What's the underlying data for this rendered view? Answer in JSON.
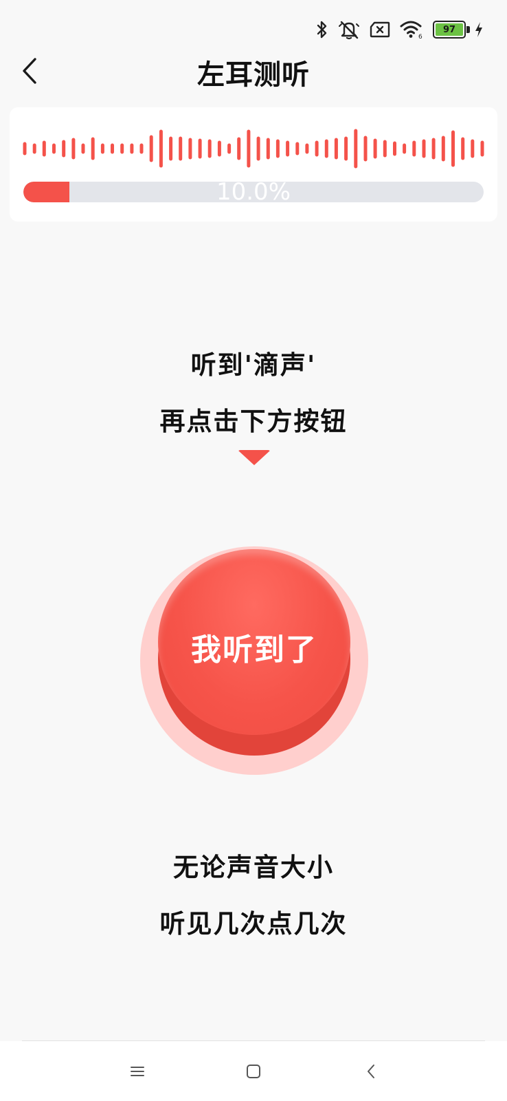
{
  "status_bar": {
    "battery_level": "97",
    "wifi_label": "6",
    "icons": [
      "bluetooth-icon",
      "mute-icon",
      "sim-icon",
      "wifi-icon",
      "battery-icon",
      "charging-icon"
    ]
  },
  "header": {
    "title": "左耳测听",
    "back_icon": "chevron-left-icon"
  },
  "progress": {
    "percent_text": "10.0%",
    "value": 0.1,
    "bar_color": "#f4524a",
    "track_color": "#e3e5ea"
  },
  "instructions": {
    "line1": "听到'滴声'",
    "line2": "再点击下方按钮"
  },
  "main_button": {
    "label": "我听到了",
    "color": "#f6544a",
    "halo_color": "#ffcfcd"
  },
  "tips": {
    "line1": "无论声音大小",
    "line2": "听见几次点几次"
  },
  "nav_bar": {
    "icons": [
      "menu-icon",
      "home-icon",
      "back-icon"
    ]
  }
}
